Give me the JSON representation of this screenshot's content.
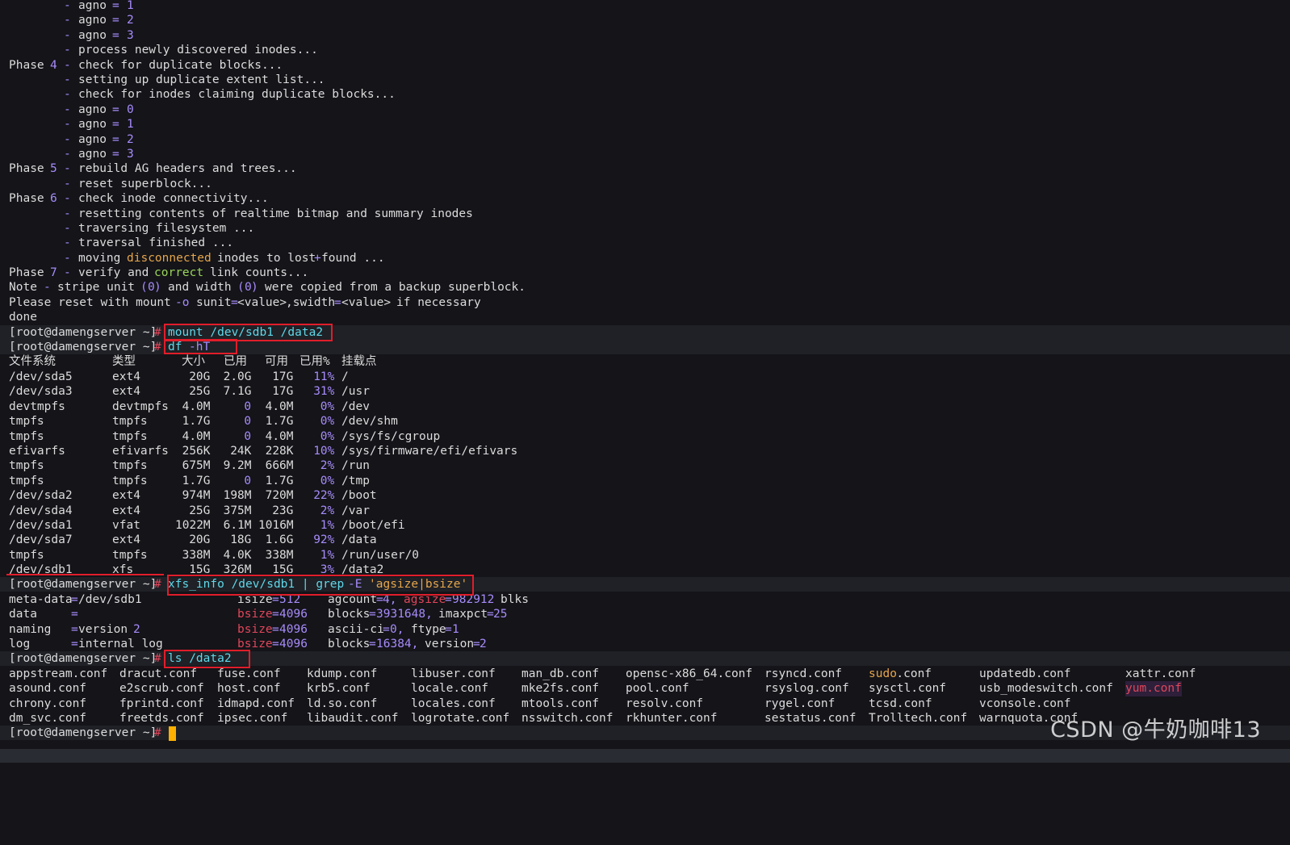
{
  "terminal": {
    "prompt": "[root@damengserver ~]",
    "prompt_hash": "#",
    "top": {
      "dash": "-",
      "agno": "agno",
      "eq": "=",
      "n0": "0",
      "n1": "1",
      "n2": "2",
      "n3": "3",
      "n4": "4",
      "n5": "5",
      "n6": "6",
      "n7": "7",
      "phase": "Phase",
      "process_inodes": "process newly discovered inodes...",
      "check_dup": "check for duplicate blocks...",
      "setting_up": "setting up duplicate extent list...",
      "check_claiming": "check for inodes claiming duplicate blocks...",
      "rebuild": "rebuild AG headers and trees...",
      "reset_sb": "reset superblock...",
      "check_conn": "check inode connectivity...",
      "resetting": "resetting contents of realtime bitmap and summary inodes",
      "traversing": "traversing filesystem ...",
      "trav_finished": "traversal finished ...",
      "moving": "moving",
      "disconnected": "disconnected",
      "inodes_to_lost": "inodes to lost",
      "plus": "+",
      "found": "found ...",
      "verify": "verify and",
      "correct": "correct",
      "link_counts": "link counts...",
      "note": "Note",
      "stripe": "stripe unit",
      "paren_open": "(",
      "paren_close": ")",
      "and_width": "and width",
      "copied": "were copied from a backup superblock.",
      "please": "Please reset with mount",
      "opt_o": "-o",
      "sunit": "sunit",
      "value_tag": "<value>",
      "swidth": ",swidth",
      "if_nec": "if necessary",
      "done": "done"
    },
    "commands": {
      "mount": "mount /dev/sdb1 /data2",
      "df": "df",
      "df_opt": "-hT",
      "xfs_info": "xfs_info /dev/sdb1 | grep",
      "xfs_opt": "-E",
      "xfs_pattern": "'agsize|bsize'",
      "ls": "ls /data2"
    },
    "df": {
      "headers": [
        "文件系统",
        "类型",
        "大小",
        "已用",
        "可用",
        "已用%",
        "挂载点"
      ],
      "rows": [
        [
          "/dev/sda5",
          "ext4",
          "20G",
          "2.0G",
          "17G",
          "11%",
          "/"
        ],
        [
          "/dev/sda3",
          "ext4",
          "25G",
          "7.1G",
          "17G",
          "31%",
          "/usr"
        ],
        [
          "devtmpfs",
          "devtmpfs",
          "4.0M",
          "0",
          "4.0M",
          "0%",
          "/dev"
        ],
        [
          "tmpfs",
          "tmpfs",
          "1.7G",
          "0",
          "1.7G",
          "0%",
          "/dev/shm"
        ],
        [
          "tmpfs",
          "tmpfs",
          "4.0M",
          "0",
          "4.0M",
          "0%",
          "/sys/fs/cgroup"
        ],
        [
          "efivarfs",
          "efivarfs",
          "256K",
          "24K",
          "228K",
          "10%",
          "/sys/firmware/efi/efivars"
        ],
        [
          "tmpfs",
          "tmpfs",
          "675M",
          "9.2M",
          "666M",
          "2%",
          "/run"
        ],
        [
          "tmpfs",
          "tmpfs",
          "1.7G",
          "0",
          "1.7G",
          "0%",
          "/tmp"
        ],
        [
          "/dev/sda2",
          "ext4",
          "974M",
          "198M",
          "720M",
          "22%",
          "/boot"
        ],
        [
          "/dev/sda4",
          "ext4",
          "25G",
          "375M",
          "23G",
          "2%",
          "/var"
        ],
        [
          "/dev/sda1",
          "vfat",
          "1022M",
          "6.1M",
          "1016M",
          "1%",
          "/boot/efi"
        ],
        [
          "/dev/sda7",
          "ext4",
          "20G",
          "18G",
          "1.6G",
          "92%",
          "/data"
        ],
        [
          "tmpfs",
          "tmpfs",
          "338M",
          "4.0K",
          "338M",
          "1%",
          "/run/user/0"
        ],
        [
          "/dev/sdb1",
          "xfs",
          "15G",
          "326M",
          "15G",
          "3%",
          "/data2"
        ]
      ]
    },
    "xfs": {
      "meta_data": "meta-data",
      "eq": "=",
      "dev": "/dev/sdb1",
      "isize": "isize",
      "isize_val": "512",
      "agcount": "agcount",
      "agcount_val": "4,",
      "agsize": "agsize",
      "agsize_val": "982912",
      "blks": "blks",
      "data": "data",
      "bsize": "bsize",
      "bsize_val": "4096",
      "blocks": "blocks",
      "blocks_val_data": "3931648,",
      "imaxpct": "imaxpct",
      "imaxpct_val": "25",
      "naming": "naming",
      "version": "version",
      "version_val_naming": "2",
      "ascii_ci": "ascii-ci",
      "ascii_ci_val": "0,",
      "ftype": "ftype",
      "ftype_val": "1",
      "log": "log",
      "internal_log": "internal log",
      "blocks_val_log": "16384,",
      "version_val_log": "2"
    },
    "ls": [
      [
        "appstream.conf",
        "asound.conf",
        "chrony.conf",
        "dm_svc.conf"
      ],
      [
        "dracut.conf",
        "e2scrub.conf",
        "fprintd.conf",
        "freetds.conf"
      ],
      [
        "fuse.conf",
        "host.conf",
        "idmapd.conf",
        "ipsec.conf"
      ],
      [
        "kdump.conf",
        "krb5.conf",
        "ld.so.conf",
        "libaudit.conf"
      ],
      [
        "libuser.conf",
        "locale.conf",
        "locales.conf",
        "logrotate.conf"
      ],
      [
        "man_db.conf",
        "mke2fs.conf",
        "mtools.conf",
        "nsswitch.conf"
      ],
      [
        "opensc-x86_64.conf",
        "pool.conf",
        "resolv.conf",
        "rkhunter.conf"
      ],
      [
        "rsyncd.conf",
        "rsyslog.conf",
        "rygel.conf",
        "sestatus.conf"
      ],
      [
        "sudo",
        "sysctl.conf",
        "tcsd.conf",
        "Trolltech.conf"
      ],
      [
        "updatedb.conf",
        "usb_modeswitch.conf",
        "vconsole.conf",
        "warnquota.conf"
      ],
      [
        "xattr.conf",
        "yum.conf",
        "",
        ""
      ]
    ],
    "ls_sudo_ext": ".conf",
    "watermark": "CSDN @牛奶咖啡13"
  },
  "colors": {
    "background": "#141419",
    "text": "#dcdcdc",
    "number": "#a78bfa",
    "command": "#5fd7e8",
    "highlight_box": "#e11d2a",
    "cursor": "#ffb000"
  }
}
